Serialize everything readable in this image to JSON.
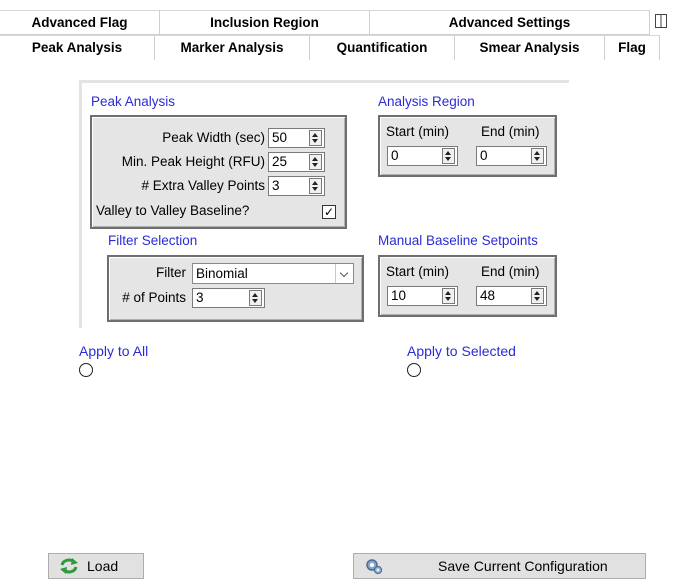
{
  "tabs_back": [
    {
      "label": "Advanced Flag"
    },
    {
      "label": "Inclusion Region"
    },
    {
      "label": "Advanced Settings"
    }
  ],
  "tabs_front": [
    {
      "label": "Peak Analysis",
      "active": true
    },
    {
      "label": "Marker Analysis"
    },
    {
      "label": "Quantification"
    },
    {
      "label": "Smear Analysis"
    },
    {
      "label": "Flag"
    }
  ],
  "peak_analysis": {
    "title": "Peak Analysis",
    "peak_width_label": "Peak Width (sec)",
    "peak_width_value": "50",
    "min_height_label": "Min. Peak Height (RFU)",
    "min_height_value": "25",
    "extra_valley_label": "# Extra Valley Points",
    "extra_valley_value": "3",
    "valley_baseline_label": "Valley to Valley Baseline?",
    "valley_baseline_checked": true
  },
  "analysis_region": {
    "title": "Analysis Region",
    "start_label": "Start (min)",
    "end_label": "End (min)",
    "start_value": "0",
    "end_value": "0"
  },
  "filter_selection": {
    "title": "Filter Selection",
    "filter_label": "Filter",
    "filter_value": "Binomial",
    "points_label": "# of Points",
    "points_value": "3"
  },
  "manual_baseline": {
    "title": "Manual Baseline Setpoints",
    "start_label": "Start (min)",
    "end_label": "End (min)",
    "start_value": "10",
    "end_value": "48"
  },
  "apply": {
    "all_label": "Apply to All",
    "selected_label": "Apply to Selected"
  },
  "buttons": {
    "load_label": "Load",
    "save_label": "Save Current Configuration"
  },
  "icons": {
    "load": "refresh-arrows-icon",
    "save": "gear-settings-icon",
    "tab_scroll": "column-layout-icon",
    "check": "✓"
  }
}
